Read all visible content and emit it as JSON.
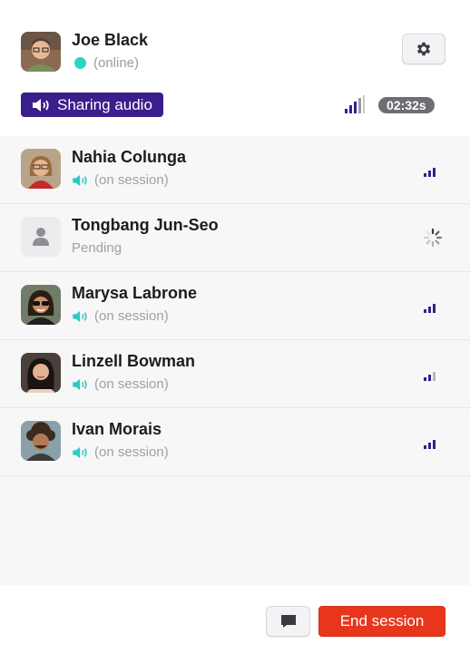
{
  "self": {
    "name": "Joe Black",
    "status": "(online)"
  },
  "sharing": {
    "label": "Sharing audio"
  },
  "timer": "02:32s",
  "participants": [
    {
      "name": "Nahia Colunga",
      "status": "(on session)"
    },
    {
      "name": "Tongbang Jun-Seo",
      "status": "Pending"
    },
    {
      "name": "Marysa Labrone",
      "status": "(on session)"
    },
    {
      "name": "Linzell Bowman",
      "status": "(on session)"
    },
    {
      "name": "Ivan Morais",
      "status": "(on session)"
    }
  ],
  "footer": {
    "end_label": "End session"
  },
  "colors": {
    "accent": "#3a1e8c",
    "online": "#2ed3c7",
    "danger": "#e8361d",
    "speaker": "#2ec9c0"
  },
  "icons": [
    "gear-icon",
    "speaker-icon",
    "signal-icon",
    "spinner-icon",
    "user-placeholder-icon",
    "chat-icon"
  ]
}
